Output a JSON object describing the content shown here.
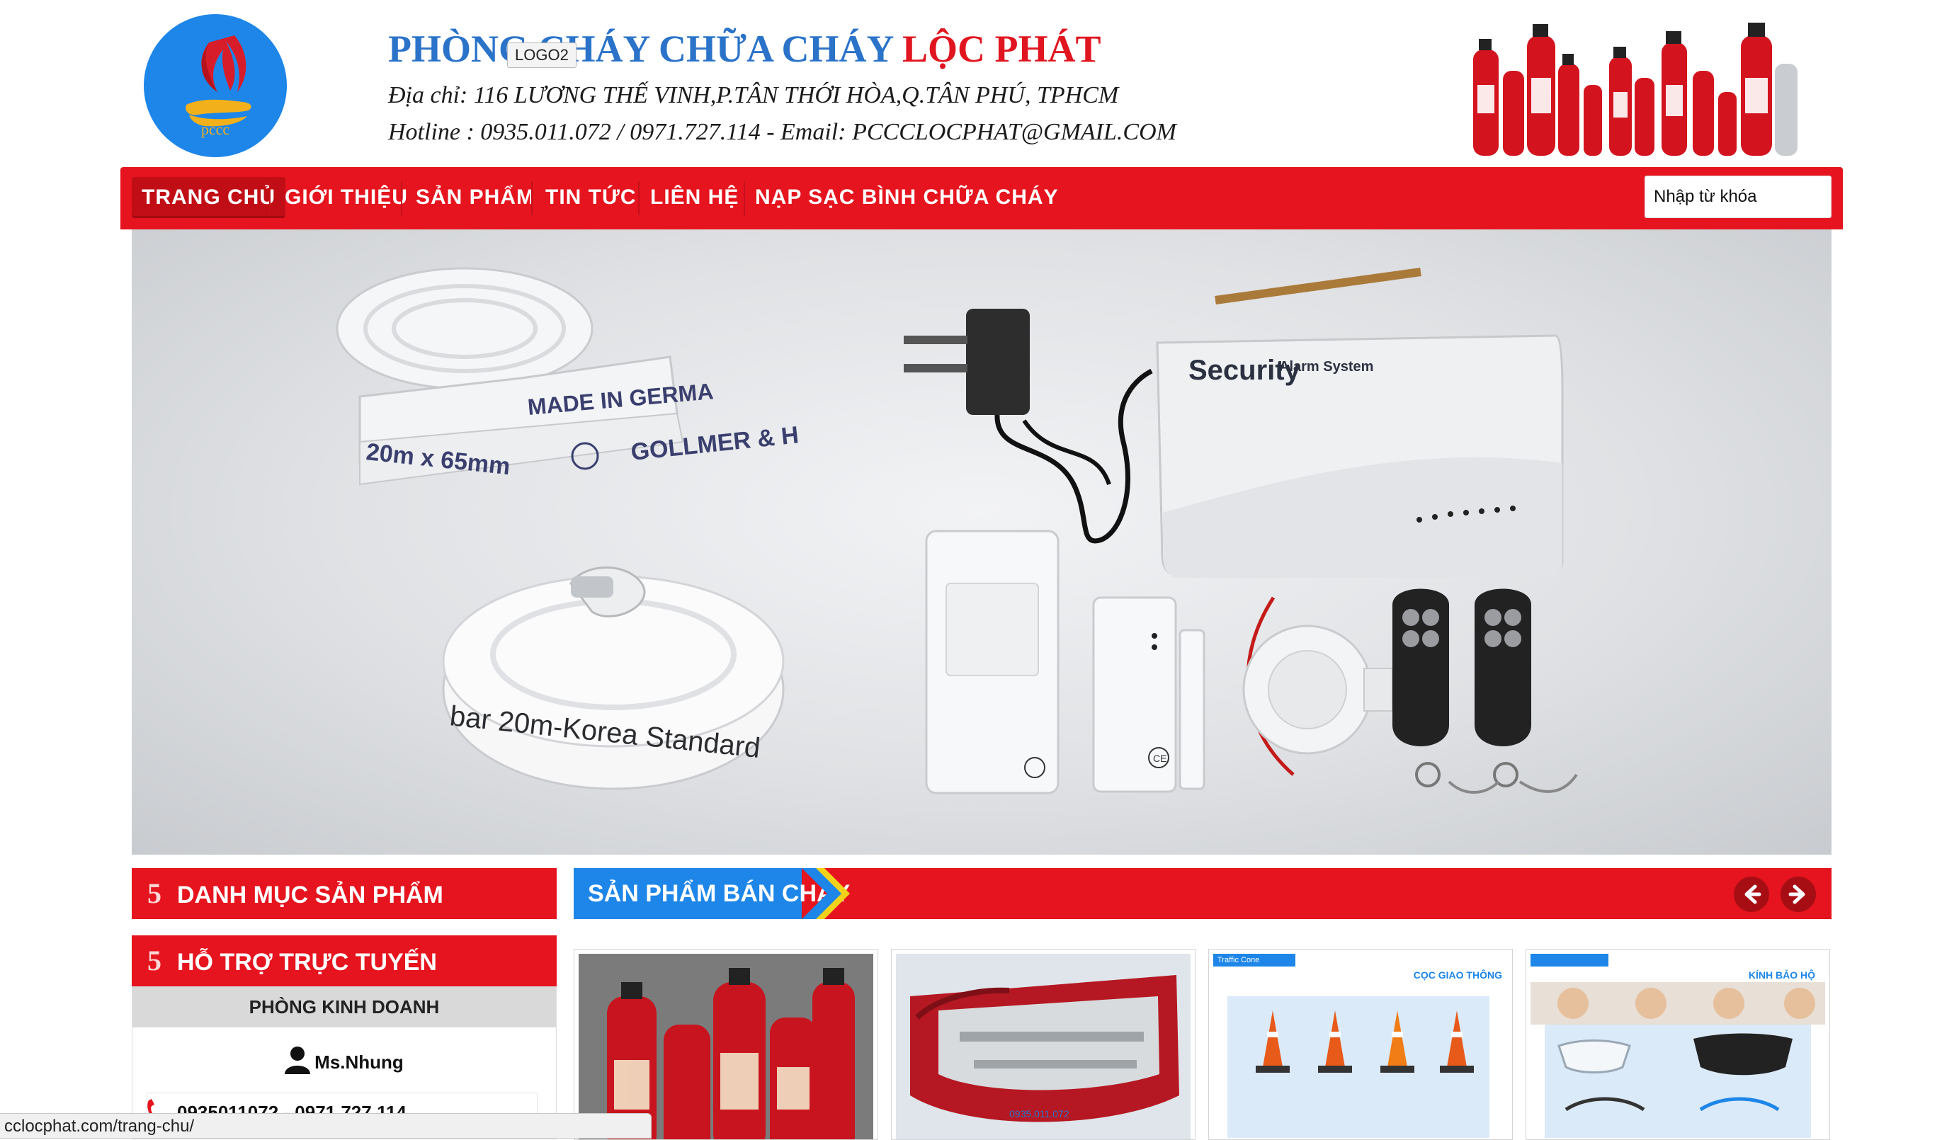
{
  "header": {
    "logo_text": "pccc",
    "title_part1": "PHÒNG CHÁY CHỮA CHÁY",
    "title_part2": "LỘC PHÁT",
    "tooltip": "LOGO2",
    "address": "Địa chỉ: 116 LƯƠNG THẾ VINH,P.TÂN THỚI HÒA,Q.TÂN PHÚ, TPHCM",
    "hotline": "Hotline : 0935.011.072 / 0971.727.114  -  Email: PCCCLOCPHAT@GMAIL.COM",
    "extinguisher_image": "fire-extinguishers-group"
  },
  "nav": {
    "items": [
      {
        "label": "TRANG CHỦ",
        "active": true
      },
      {
        "label": "GIỚI THIỆU",
        "active": false
      },
      {
        "label": "SẢN PHẨM",
        "active": false
      },
      {
        "label": "TIN TỨC",
        "active": false
      },
      {
        "label": "LIÊN HỆ",
        "active": false
      },
      {
        "label": "NẠP SẠC BÌNH CHỮA CHÁY",
        "active": false
      }
    ],
    "search_placeholder": "Nhập từ khóa"
  },
  "banner": {
    "hose1_text_top": "MADE IN GERMA",
    "hose1_text_bottom": "20m x 65mm",
    "hose1_brand": "GOLLMER & H",
    "hose2_text": "bar 20m-Korea Standard",
    "alarm_brand": "Security",
    "alarm_sub": "Alarm System",
    "ce_mark": "CE"
  },
  "sidebar": {
    "category_heading": "DANH MỤC SẢN PHẨM",
    "support_heading": "HỖ TRỢ TRỰC TUYẾN",
    "department": "PHÒNG KINH DOANH",
    "contact_name": "Ms.Nhung",
    "contact_phone": "0935011072 - 0971.727.114",
    "heading_icon": "5"
  },
  "best_sellers": {
    "heading": "SẢN PHẨM BÁN CHẠY",
    "prev_icon": "arrow-left-icon",
    "next_icon": "arrow-right-icon",
    "products": [
      {
        "image": "fire-extinguishers"
      },
      {
        "image": "inflatable-boat",
        "caption": "0935.011.072"
      },
      {
        "image": "traffic-cones",
        "caption": "CỌC GIAO THÔNG",
        "tag": "Traffic Cone"
      },
      {
        "image": "safety-glasses",
        "caption": "KÍNH BẢO HỘ"
      }
    ]
  },
  "status_bar": {
    "url": "cclocphat.com/trang-chu/"
  },
  "colors": {
    "brand_red": "#e5141e",
    "brand_blue": "#1d86e8"
  }
}
